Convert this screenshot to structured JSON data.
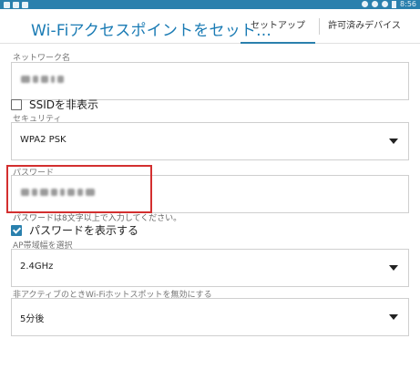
{
  "status_bar": {
    "time": "8:56",
    "left_icons": [
      "notification-icon",
      "notification-icon",
      "image-icon"
    ],
    "right_icons": [
      "moon-icon",
      "wifi-icon",
      "signal-icon",
      "battery-icon"
    ],
    "color": "#2a80ad"
  },
  "app_bar": {
    "title": "Wi-Fiアクセスポイントをセット...",
    "tabs": [
      {
        "label": "セットアップ",
        "selected": true
      },
      {
        "label": "許可済みデバイス",
        "selected": false
      }
    ],
    "accent": "#1a7bb4"
  },
  "form": {
    "network_name": {
      "label": "ネットワーク名",
      "value_obscured": true
    },
    "hide_ssid": {
      "label": "SSIDを非表示",
      "checked": false
    },
    "security": {
      "label": "セキュリティ",
      "value": "WPA2 PSK"
    },
    "password": {
      "label": "パスワード",
      "value_obscured": true,
      "hint": "パスワードは8文字以上で入力してください。"
    },
    "show_password": {
      "label": "パスワードを表示する",
      "checked": true
    },
    "ap_band": {
      "label": "AP帯域幅を選択",
      "value": "2.4GHz"
    },
    "inactive_timeout": {
      "label": "非アクティブのときWi-Fiホットスポットを無効にする",
      "value": "5分後"
    }
  },
  "annotation": {
    "color": "#d32f2f"
  }
}
